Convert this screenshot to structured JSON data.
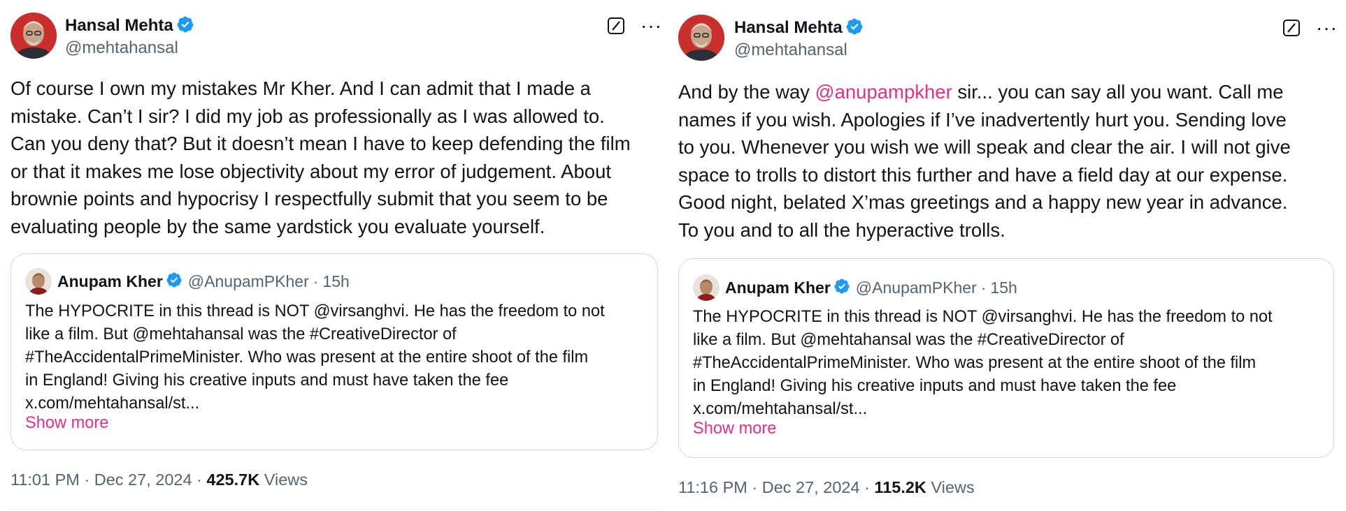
{
  "colors": {
    "mention": "#e0308a",
    "verified": "#1d9bf0",
    "secondary_text": "#536471"
  },
  "tweets": [
    {
      "author": {
        "name": "Hansal Mehta",
        "handle": "@mehtahansal",
        "avatar_icon": "avatar-photo",
        "verified_icon": "verified-badge-icon"
      },
      "text_lines": [
        "Of course I own my mistakes Mr Kher. And I can admit that I made a",
        "mistake. Can’t I sir? I did my job as professionally as I was allowed to.",
        "Can you deny that? But it doesn’t mean I have to keep defending the film",
        "or that it makes me lose objectivity about my error of judgement. About",
        "brownie points and hypocrisy I respectfully submit that you seem to be",
        "evaluating people by the same yardstick you evaluate yourself."
      ],
      "quote": {
        "name": "Anupam Kher",
        "handle": "@AnupamPKher",
        "time": "15h",
        "text_lines": [
          "The HYPOCRITE in this thread is NOT @virsanghvi. He has the freedom to not",
          "like a film. But @mehtahansal was the #CreativeDirector of",
          "#TheAccidentalPrimeMinister. Who was present at the entire shoot of the film",
          "in England! Giving his creative inputs and must have taken the fee",
          "x.com/mehtahansal/st..."
        ],
        "show_more": "Show more"
      },
      "time": "11:01 PM",
      "date": "Dec 27, 2024",
      "views_count": "425.7K",
      "views_label": "Views"
    },
    {
      "author": {
        "name": "Hansal Mehta",
        "handle": "@mehtahansal",
        "avatar_icon": "avatar-photo",
        "verified_icon": "verified-badge-icon"
      },
      "text_first_prefix": "And by the way ",
      "text_first_mention": "@anupampkher",
      "text_first_suffix": " sir... you can say all you want. Call me",
      "text_lines": [
        "names if you wish. Apologies if I’ve inadvertently hurt you. Sending love",
        "to you. Whenever you wish we will speak and clear the air. I will not give",
        "space to trolls to distort this further and have a field day at our expense.",
        "Good night, belated X’mas greetings and a happy new year in advance.",
        "To you and to all the hyperactive trolls."
      ],
      "quote": {
        "name": "Anupam Kher",
        "handle": "@AnupamPKher",
        "time": "15h",
        "text_lines": [
          "The HYPOCRITE in this thread is NOT @virsanghvi. He has the freedom to not",
          "like a film. But @mehtahansal was the #CreativeDirector of",
          "#TheAccidentalPrimeMinister. Who was present at the entire shoot of the film",
          "in England! Giving his creative inputs and must have taken the fee",
          "x.com/mehtahansal/st..."
        ],
        "show_more": "Show more"
      },
      "time": "11:16 PM",
      "date": "Dec 27, 2024",
      "views_count": "115.2K",
      "views_label": "Views"
    }
  ]
}
